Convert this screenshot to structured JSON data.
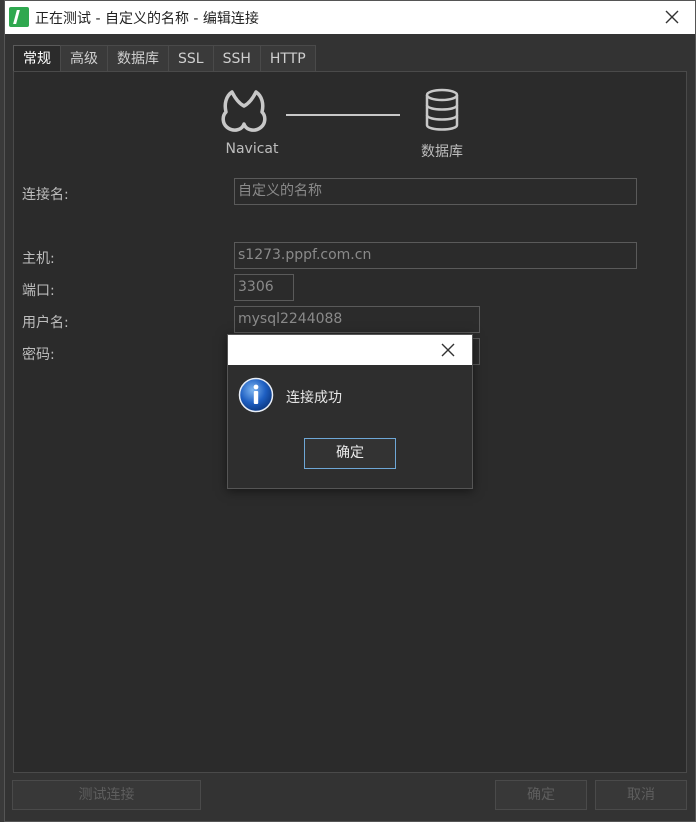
{
  "window": {
    "title": "正在测试 - 自定义的名称 - 编辑连接"
  },
  "tabs": [
    {
      "label": "常规",
      "active": true
    },
    {
      "label": "高级",
      "active": false
    },
    {
      "label": "数据库",
      "active": false
    },
    {
      "label": "SSL",
      "active": false
    },
    {
      "label": "SSH",
      "active": false
    },
    {
      "label": "HTTP",
      "active": false
    }
  ],
  "diagram": {
    "left_label": "Navicat",
    "right_label": "数据库"
  },
  "form": {
    "connection_name_label": "连接名:",
    "connection_name_value": "自定义的名称",
    "host_label": "主机:",
    "host_value": "s1273.pppf.com.cn",
    "port_label": "端口:",
    "port_value": "3306",
    "user_label": "用户名:",
    "user_value": "mysql2244088",
    "password_label": "密码:"
  },
  "buttons": {
    "test_connection": "测试连接",
    "ok": "确定",
    "cancel": "取消"
  },
  "dialog": {
    "message": "连接成功",
    "ok": "确定"
  },
  "colors": {
    "accent": "#6ea7d6",
    "background": "#2b2b2b",
    "info_icon": "#1e5fc2"
  },
  "icons": {
    "navicat": "navicat-icon",
    "database": "database-icon",
    "info": "info-icon",
    "close": "close-icon"
  }
}
